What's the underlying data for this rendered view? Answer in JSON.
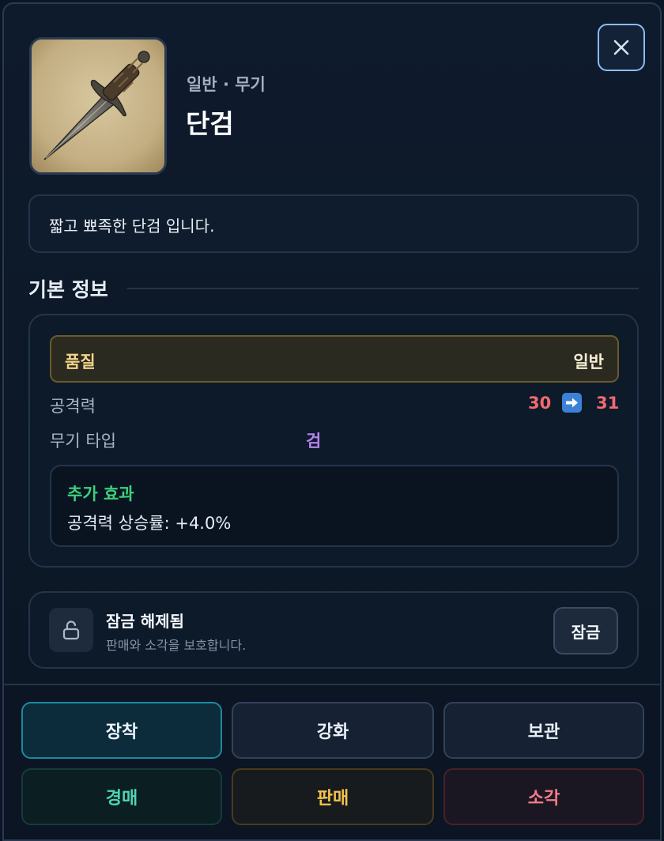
{
  "item": {
    "category": "일반 · 무기",
    "name": "단검",
    "description": "짧고 뾰족한 단검 입니다."
  },
  "basic_info": {
    "section_title": "기본 정보",
    "quality_label": "품질",
    "quality_value": "일반",
    "attack_label": "공격력",
    "attack_from": "30",
    "attack_to": "31",
    "weapon_type_label": "무기 타입",
    "weapon_type_value": "검",
    "extra_title": "추가 효과",
    "extra_effect": "공격력 상승률: +4.0%"
  },
  "lock": {
    "title": "잠금 해제됨",
    "subtitle": "판매와 소각을 보호합니다.",
    "button_label": "잠금"
  },
  "actions": {
    "equip": "장착",
    "enhance": "강화",
    "store": "보관",
    "auction": "경매",
    "sell": "판매",
    "burn": "소각"
  },
  "icons": {
    "close": "close-icon",
    "lock": "unlock-icon",
    "arrow": "right-arrow-icon",
    "item": "dagger-icon"
  }
}
